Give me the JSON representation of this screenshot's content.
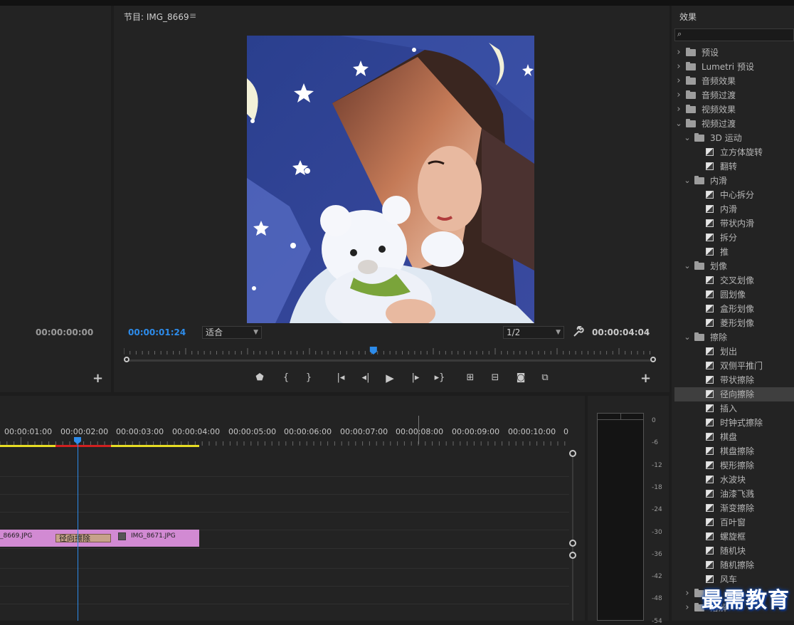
{
  "program": {
    "title": "节目: IMG_8669",
    "current_timecode": "00:00:01:24",
    "zoom": "适合",
    "resolution": "1/2",
    "duration": "00:00:04:04",
    "playhead_fraction": 0.469
  },
  "source": {
    "timecode": "00:00:00:00"
  },
  "effects": {
    "title": "效果",
    "search_value": "",
    "items": [
      {
        "level": 0,
        "type": "folder",
        "open": false,
        "label": "预设",
        "locked": true
      },
      {
        "level": 0,
        "type": "folder",
        "open": false,
        "label": "Lumetri 预设",
        "locked": true
      },
      {
        "level": 0,
        "type": "folder",
        "open": false,
        "label": "音频效果"
      },
      {
        "level": 0,
        "type": "folder",
        "open": false,
        "label": "音频过渡"
      },
      {
        "level": 0,
        "type": "folder",
        "open": false,
        "label": "视频效果"
      },
      {
        "level": 0,
        "type": "folder",
        "open": true,
        "label": "视频过渡"
      },
      {
        "level": 1,
        "type": "folder",
        "open": true,
        "label": "3D 运动"
      },
      {
        "level": 2,
        "type": "transition",
        "label": "立方体旋转"
      },
      {
        "level": 2,
        "type": "transition",
        "label": "翻转"
      },
      {
        "level": 1,
        "type": "folder",
        "open": true,
        "label": "内滑"
      },
      {
        "level": 2,
        "type": "transition",
        "label": "中心拆分"
      },
      {
        "level": 2,
        "type": "transition",
        "label": "内滑"
      },
      {
        "level": 2,
        "type": "transition",
        "label": "带状内滑"
      },
      {
        "level": 2,
        "type": "transition",
        "label": "拆分"
      },
      {
        "level": 2,
        "type": "transition",
        "label": "推"
      },
      {
        "level": 1,
        "type": "folder",
        "open": true,
        "label": "划像"
      },
      {
        "level": 2,
        "type": "transition",
        "label": "交叉划像"
      },
      {
        "level": 2,
        "type": "transition",
        "label": "圆划像"
      },
      {
        "level": 2,
        "type": "transition",
        "label": "盒形划像"
      },
      {
        "level": 2,
        "type": "transition",
        "label": "菱形划像"
      },
      {
        "level": 1,
        "type": "folder",
        "open": true,
        "label": "擦除"
      },
      {
        "level": 2,
        "type": "transition",
        "label": "划出"
      },
      {
        "level": 2,
        "type": "transition",
        "label": "双侧平推门"
      },
      {
        "level": 2,
        "type": "transition",
        "label": "带状擦除"
      },
      {
        "level": 2,
        "type": "transition",
        "label": "径向擦除",
        "selected": true
      },
      {
        "level": 2,
        "type": "transition",
        "label": "插入"
      },
      {
        "level": 2,
        "type": "transition",
        "label": "时钟式擦除"
      },
      {
        "level": 2,
        "type": "transition",
        "label": "棋盘"
      },
      {
        "level": 2,
        "type": "transition",
        "label": "棋盘擦除"
      },
      {
        "level": 2,
        "type": "transition",
        "label": "楔形擦除"
      },
      {
        "level": 2,
        "type": "transition",
        "label": "水波块"
      },
      {
        "level": 2,
        "type": "transition",
        "label": "油漆飞溅"
      },
      {
        "level": 2,
        "type": "transition",
        "label": "渐变擦除"
      },
      {
        "level": 2,
        "type": "transition",
        "label": "百叶窗"
      },
      {
        "level": 2,
        "type": "transition",
        "label": "螺旋框"
      },
      {
        "level": 2,
        "type": "transition",
        "label": "随机块"
      },
      {
        "level": 2,
        "type": "transition",
        "label": "随机擦除"
      },
      {
        "level": 2,
        "type": "transition",
        "label": "风车"
      },
      {
        "level": 1,
        "type": "folder",
        "open": false,
        "label": ""
      },
      {
        "level": 1,
        "type": "folder",
        "open": false,
        "label": "溶解"
      }
    ]
  },
  "timeline": {
    "ruler_labels": [
      "00:00:01:00",
      "00:00:02:00",
      "00:00:03:00",
      "00:00:04:00",
      "00:00:05:00",
      "00:00:06:00",
      "00:00:07:00",
      "00:00:08:00",
      "00:00:09:00",
      "00:00:10:00",
      "0"
    ],
    "clip_a": "_8669.JPG",
    "transition_label": "径向擦除",
    "clip_b": "IMG_8671.JPG"
  },
  "meter": {
    "labels": [
      "0",
      "-6",
      "-12",
      "-18",
      "-24",
      "-30",
      "-36",
      "-42",
      "-48",
      "-54"
    ]
  },
  "watermark": "最需教育",
  "colors": {
    "accent_blue": "#2d8ceb",
    "clip_pink": "#d28ad3",
    "transition_tan": "#c7a28a",
    "render_yellow": "#e6dc24",
    "render_red": "#d02020"
  }
}
